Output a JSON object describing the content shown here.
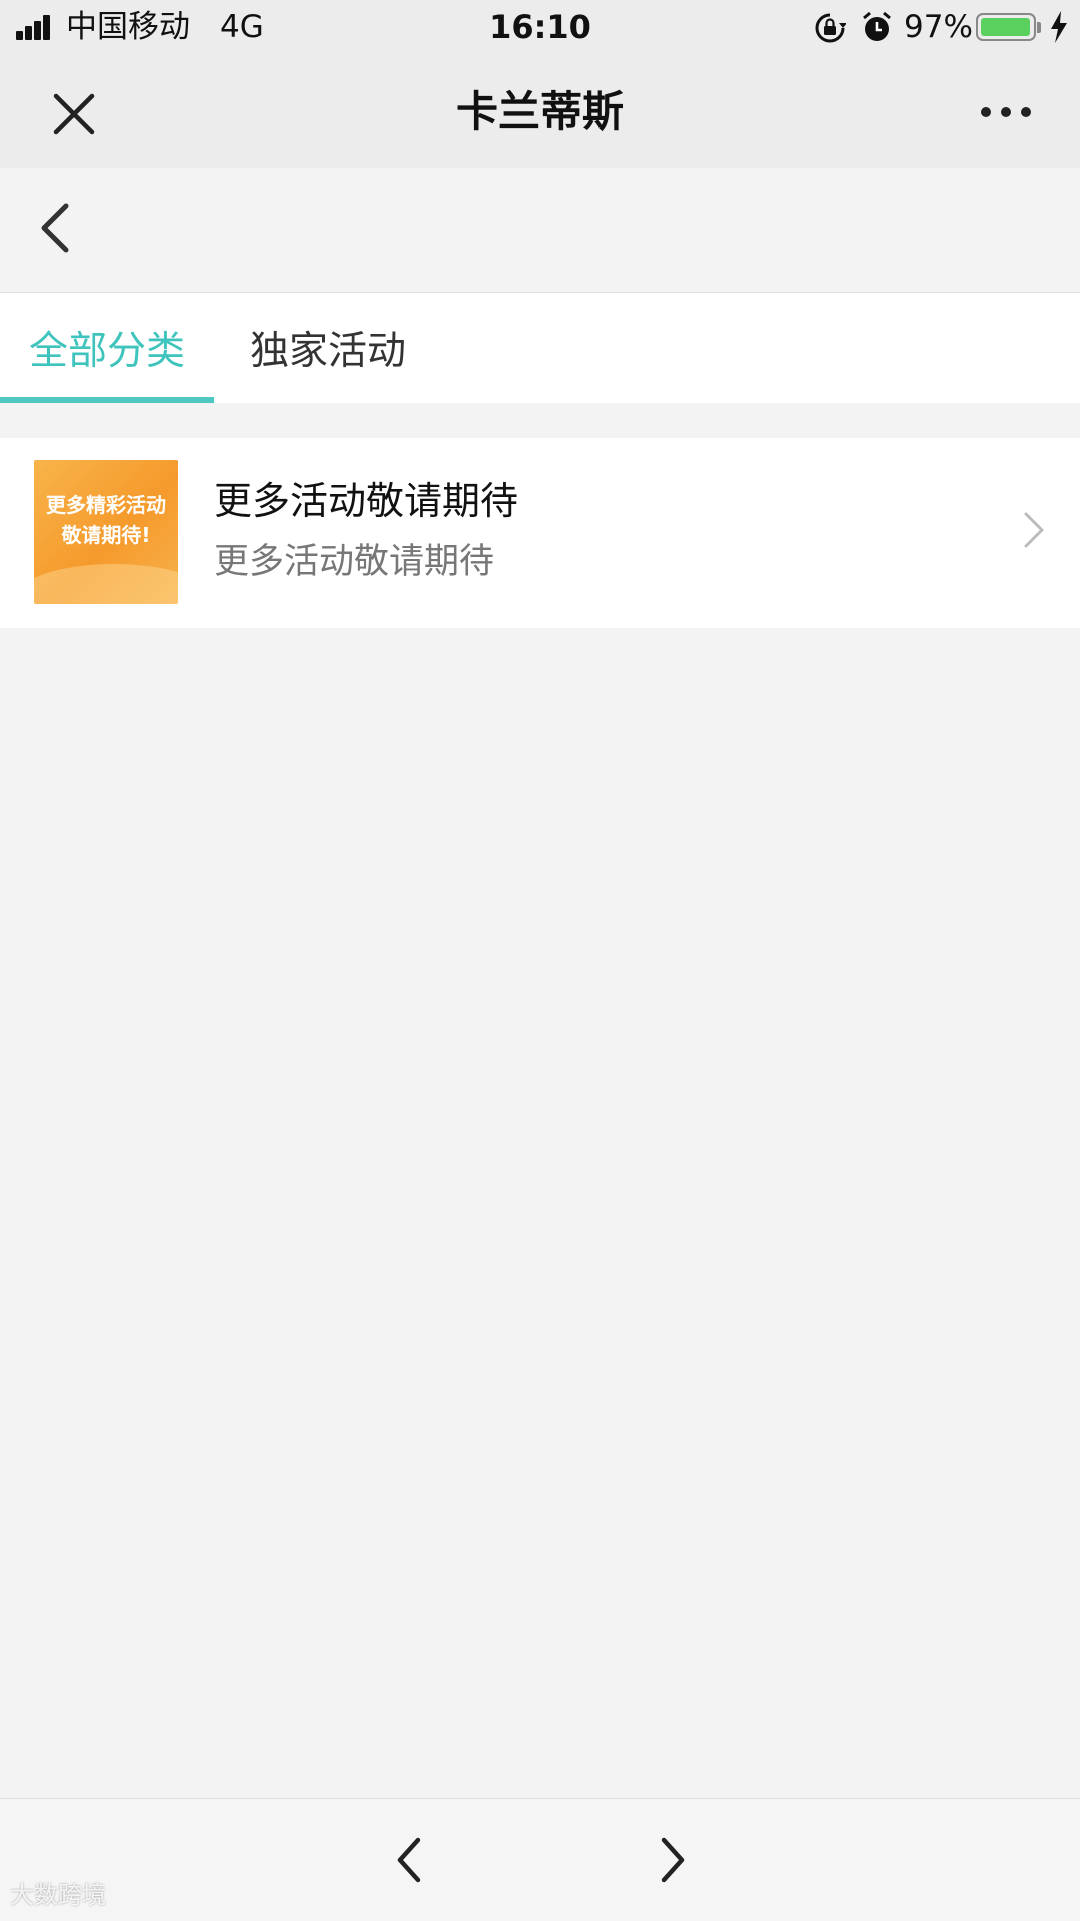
{
  "status_bar": {
    "carrier": "中国移动",
    "network": "4G",
    "time": "16:10",
    "battery_percent": "97%",
    "battery_level": 0.97,
    "icons": [
      "signal-icon",
      "orientation-lock-icon",
      "alarm-icon",
      "battery-icon",
      "charging-bolt-icon"
    ]
  },
  "nav": {
    "title": "卡兰蒂斯",
    "close_icon": "close-icon",
    "more_icon": "more-dots-icon"
  },
  "back_icon": "chevron-left-icon",
  "tabs": [
    {
      "label": "全部分类",
      "active": true
    },
    {
      "label": "独家活动",
      "active": false
    }
  ],
  "colors": {
    "accent": "#3ec3bd",
    "thumbnail": "#f59a2c",
    "battery": "#5ad05e"
  },
  "list": [
    {
      "thumbnail_text": "更多精彩活动\n敬请期待!",
      "title": "更多活动敬请期待",
      "subtitle": "更多活动敬请期待"
    }
  ],
  "bottom_bar": {
    "back_icon": "chevron-left-icon",
    "forward_icon": "chevron-right-icon"
  },
  "watermark": "大数跨境"
}
